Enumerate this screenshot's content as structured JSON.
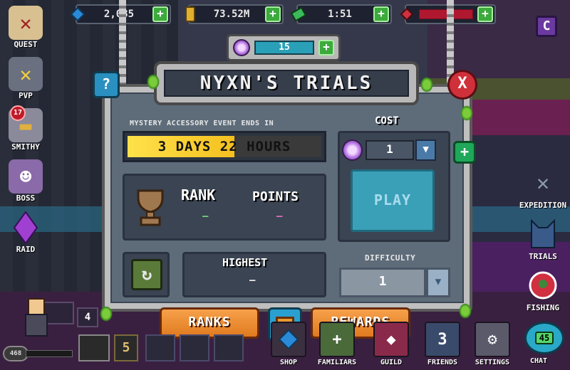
{
  "resources": [
    {
      "icon": "diamond-icon",
      "value": "2,035",
      "color": "#2a8ad8"
    },
    {
      "icon": "coin-icon",
      "value": "73.52M",
      "color": "#e0b030"
    },
    {
      "icon": "energy-icon",
      "value": "1:51",
      "color": "#3aba5a"
    },
    {
      "icon": "heart-icon",
      "value": "",
      "color": "#d03040"
    }
  ],
  "left_menu": [
    {
      "key": "quest",
      "label": "QUEST",
      "icon": "scroll-icon"
    },
    {
      "key": "pvp",
      "label": "PVP",
      "icon": "crossed-swords-icon"
    },
    {
      "key": "smithy",
      "label": "SMITHY",
      "icon": "anvil-icon",
      "badge": "17"
    },
    {
      "key": "boss",
      "label": "BOSS",
      "icon": "boss-skull-icon"
    },
    {
      "key": "raid",
      "label": "RAID",
      "icon": "crystal-icon"
    }
  ],
  "right_menu": [
    {
      "key": "expedition",
      "label": "EXPEDITION",
      "icon": "crossed-blades-icon"
    },
    {
      "key": "trials",
      "label": "TRIALS",
      "icon": "cat-head-icon"
    },
    {
      "key": "fishing",
      "label": "FISHING",
      "icon": "fishing-bobber-icon"
    }
  ],
  "top_left_extra": {
    "badge": "C"
  },
  "dialog": {
    "gems": "15",
    "title": "NYXN'S TRIALS",
    "help_label": "?",
    "close_label": "X",
    "event_label": "MYSTERY ACCESSORY EVENT ENDS IN",
    "timer_text": "3 DAYS 22 HOURS",
    "timer_progress": 0.55,
    "rank_label": "RANK",
    "points_label": "POINTS",
    "rank_value": "—",
    "points_value": "—",
    "highest_label": "HIGHEST",
    "highest_value": "—",
    "cost_label": "COST",
    "cost_value": "1",
    "play_label": "PLAY",
    "difficulty_label": "DIFFICULTY",
    "difficulty_value": "1",
    "ranks_label": "RANKS",
    "rewards_label": "REWARDS"
  },
  "bottom_bar": [
    {
      "key": "shop",
      "label": "SHOP",
      "icon": "shop-gem-icon"
    },
    {
      "key": "familiars",
      "label": "FAMILIARS",
      "icon": "familiars-icon"
    },
    {
      "key": "guild",
      "label": "GUILD",
      "icon": "guild-banner-icon"
    },
    {
      "key": "friends",
      "label": "FRIENDS",
      "icon": "friends-icon",
      "count": "3"
    },
    {
      "key": "settings",
      "label": "SETTINGS",
      "icon": "gear-icon"
    }
  ],
  "chat": {
    "label": "CHAT",
    "count": "45"
  },
  "player": {
    "level": "468",
    "count_a": "4",
    "count_b": "5"
  }
}
